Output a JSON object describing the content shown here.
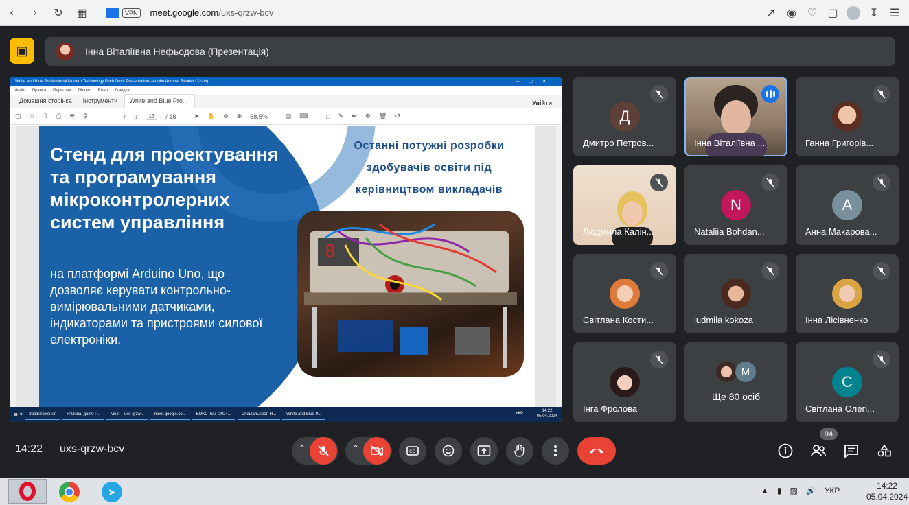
{
  "browser": {
    "url_host": "meet.google.com",
    "url_path": "/uxs-qrzw-bcv",
    "vpn_label": "VPN"
  },
  "presentation": {
    "presenter_label": "Інна Віталіївна Нефьодова (Презентація)"
  },
  "shared_screen": {
    "acrobat_title": "White and Blue Professional Modern Technology Pitch Deck Presentation - Adobe Acrobat Reader (32-bit)",
    "menu": [
      "Файл",
      "Правка",
      "Перегляд",
      "Підпис",
      "Вікно",
      "Довідка"
    ],
    "tabs": [
      "Домашня сторінка",
      "Інструменти",
      "White and Blue Pro..."
    ],
    "sign_in": "Увійти",
    "page_current": "13",
    "page_total": "/ 18",
    "zoom": "58,5%",
    "slide": {
      "title": "Стенд для проектування та програмування мікроконтролерних систем управління",
      "body": "на платформі Arduino Uno, що дозволяє керувати контрольно-вимірювальними датчиками, індикаторами та пристроями силової електроніки.",
      "side_title": "Останні потужні розробки здобувачів освіти під керівництвом викладачів"
    },
    "taskbar": {
      "items": [
        "Завантаження",
        "F:\\Инна_дох\\0 Р...",
        "Meet – uxs-qrzw...",
        "meet.google.co...",
        "ЕМКС_бак_2024...",
        "Спеціальності Н...",
        "White and Blue P..."
      ],
      "lang": "УКР",
      "time": "14:22",
      "date": "05.04.2024"
    }
  },
  "participants": [
    {
      "name": "Дмитро Петров...",
      "initial": "Д",
      "color": "#5d4037"
    },
    {
      "name": "Інна Віталіївна ...",
      "initial": "",
      "color": "#c9b9a6"
    },
    {
      "name": "Ганна Григорів...",
      "initial": "",
      "color": "#6d4c41"
    },
    {
      "name": "Людмила Калін...",
      "initial": "",
      "color": "#e8d6c1"
    },
    {
      "name": "Nataliia Bohdan...",
      "initial": "N",
      "color": "#c2185b"
    },
    {
      "name": "Анна Макарова...",
      "initial": "A",
      "color": "#78909c"
    },
    {
      "name": "Світлана Кости...",
      "initial": "",
      "color": "#f5c6a0"
    },
    {
      "name": "ludmila kokoza",
      "initial": "",
      "color": "#5d3a2a"
    },
    {
      "name": "Інна Лісівненко",
      "initial": "",
      "color": "#d9a441"
    },
    {
      "name": "Інга Фролова",
      "initial": "",
      "color": "#3b2a2a"
    },
    {
      "name": "Ще 80 осіб",
      "initial": "M",
      "color": "#607d8b"
    },
    {
      "name": "Світлана Олегі...",
      "initial": "C",
      "color": "#00838f"
    }
  ],
  "meeting": {
    "time": "14:22",
    "code": "uxs-qrzw-bcv",
    "people_count": "94"
  },
  "windows_taskbar": {
    "lang": "УКР",
    "time": "14:22",
    "date": "05.04.2024"
  },
  "colors": {
    "meet_bg": "#202124",
    "end_call": "#ea4335",
    "slide_blue": "#1a61a8"
  }
}
